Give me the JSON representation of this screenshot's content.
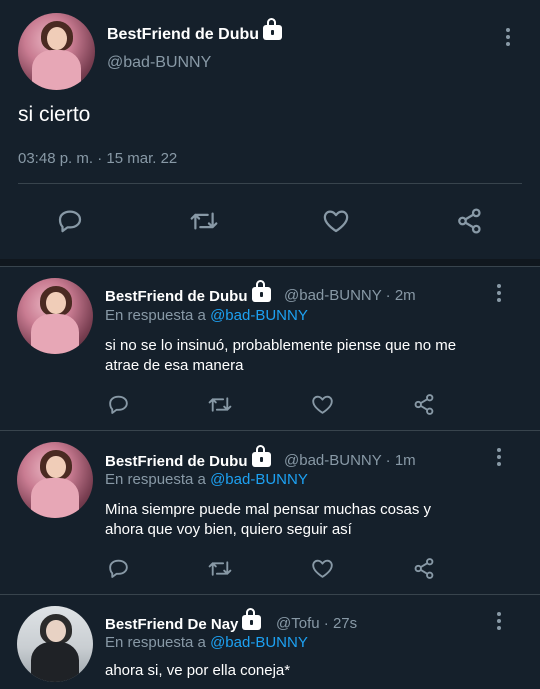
{
  "main_tweet": {
    "name": "BestFriend de Dubu",
    "handle": "@bad-BUNNY",
    "text": "si cierto",
    "time": "03:48 p. m.",
    "date": "15 mar. 22",
    "separator": " · "
  },
  "replies": [
    {
      "name": "BestFriend de Dubu",
      "handle": "@bad-BUNNY",
      "age": "2m",
      "reply_prefix": "En respuesta a ",
      "reply_to": "@bad-BUNNY",
      "text_line1": "si no se lo insinuó, probablemente piense que no me",
      "text_line2": "atrae de esa manera"
    },
    {
      "name": "BestFriend de Dubu",
      "handle": "@bad-BUNNY",
      "age": "1m",
      "reply_prefix": "En respuesta a ",
      "reply_to": "@bad-BUNNY",
      "text_line1": "Mina siempre puede mal pensar muchas cosas y",
      "text_line2": "ahora que voy bien, quiero seguir así"
    },
    {
      "name": "BestFriend De Nay",
      "handle": "@Tofu",
      "age": "27s",
      "reply_prefix": "En respuesta a ",
      "reply_to": "@bad-BUNNY",
      "text_line1": "ahora si, ve por ella coneja*"
    }
  ],
  "icons": {
    "reply": "reply-icon",
    "retweet": "retweet-icon",
    "like": "heart-icon",
    "share": "share-icon",
    "more": "more-vertical-icon",
    "protected": "lock-icon"
  },
  "colors": {
    "background": "#15202b",
    "muted": "#8899a6",
    "link": "#1da1f2",
    "divider": "#38444d"
  }
}
